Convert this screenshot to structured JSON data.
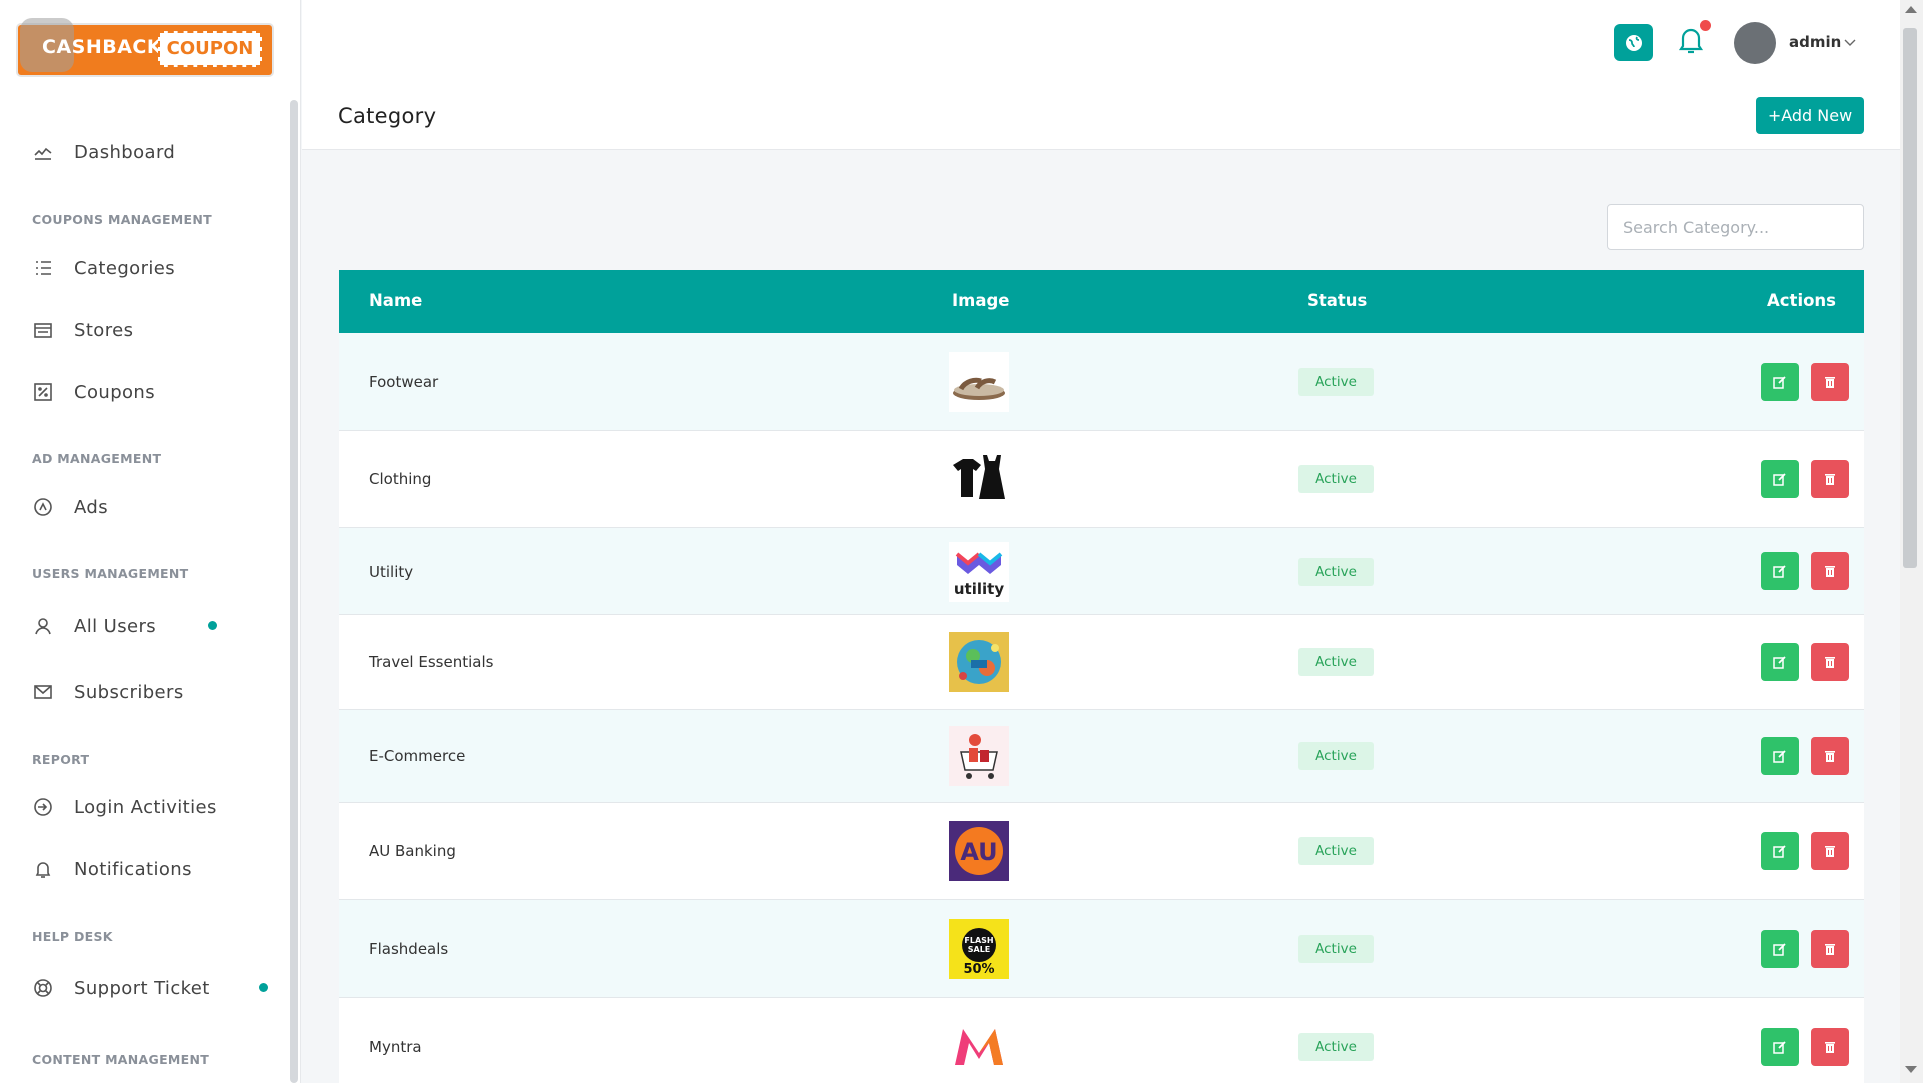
{
  "brand": {
    "left": "CASHBACK",
    "right": "COUPON"
  },
  "sidebar": {
    "dashboard": "Dashboard",
    "sections": {
      "coupons": "COUPONS MANAGEMENT",
      "ads": "AD MANAGEMENT",
      "users": "USERS MANAGEMENT",
      "report": "REPORT",
      "help": "HELP DESK",
      "content": "CONTENT MANAGEMENT"
    },
    "items": {
      "categories": "Categories",
      "stores": "Stores",
      "coupons": "Coupons",
      "ads": "Ads",
      "all_users": "All Users",
      "subscribers": "Subscribers",
      "login_activities": "Login Activities",
      "notifications": "Notifications",
      "support_ticket": "Support Ticket"
    }
  },
  "topbar": {
    "user": "admin"
  },
  "page": {
    "title": "Category",
    "add_label": "+Add New",
    "search_placeholder": "Search Category..."
  },
  "table": {
    "headers": {
      "name": "Name",
      "image": "Image",
      "status": "Status",
      "actions": "Actions"
    },
    "rows": [
      {
        "name": "Footwear",
        "image": "sandal",
        "status": "Active"
      },
      {
        "name": "Clothing",
        "image": "clothes",
        "status": "Active"
      },
      {
        "name": "Utility",
        "image": "utility-logo",
        "status": "Active"
      },
      {
        "name": "Travel Essentials",
        "image": "travel-illustration",
        "status": "Active"
      },
      {
        "name": "E-Commerce",
        "image": "shopping-cart",
        "status": "Active"
      },
      {
        "name": "AU Banking",
        "image": "au-logo",
        "status": "Active"
      },
      {
        "name": "Flashdeals",
        "image": "flash-sale-badge",
        "status": "Active"
      },
      {
        "name": "Myntra",
        "image": "myntra-logo",
        "status": "Active"
      }
    ],
    "utility_logo_text": "utility",
    "au_logo_text": "AU",
    "flash_text": {
      "line1": "FLASH",
      "line2": "SALE",
      "pct": "50%"
    }
  },
  "colors": {
    "accent": "#00a19a",
    "brand_orange": "#f07c1e",
    "edit": "#2fc26a",
    "delete": "#e8525b",
    "active_bg": "#dcf5e7",
    "active_text": "#29a35a"
  }
}
